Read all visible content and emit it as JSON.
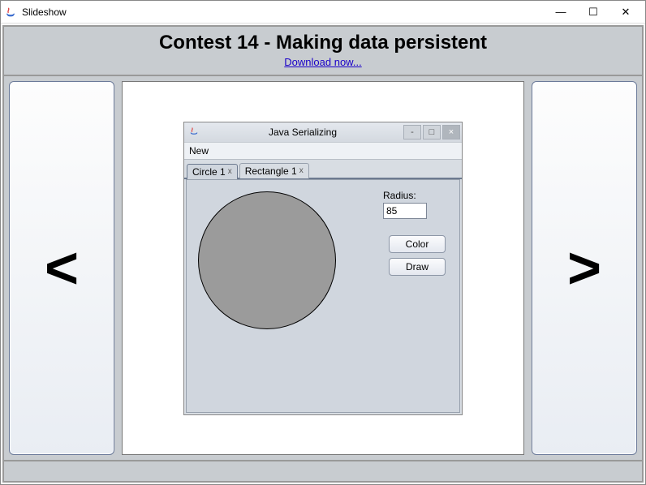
{
  "window": {
    "title": "Slideshow"
  },
  "header": {
    "title": "Contest 14 - Making data persistent",
    "download_link": "Download now..."
  },
  "nav": {
    "prev_glyph": "<",
    "next_glyph": ">"
  },
  "inner": {
    "title": "Java Serializing",
    "menu": {
      "new": "New"
    },
    "tabs": [
      {
        "label": "Circle 1",
        "close": "x"
      },
      {
        "label": "Rectangle 1",
        "close": "x"
      }
    ],
    "panel": {
      "radius_label": "Radius:",
      "radius_value": "85",
      "color_btn": "Color",
      "draw_btn": "Draw"
    }
  },
  "win_controls": {
    "minimize": "—",
    "maximize": "☐",
    "close": "✕"
  }
}
